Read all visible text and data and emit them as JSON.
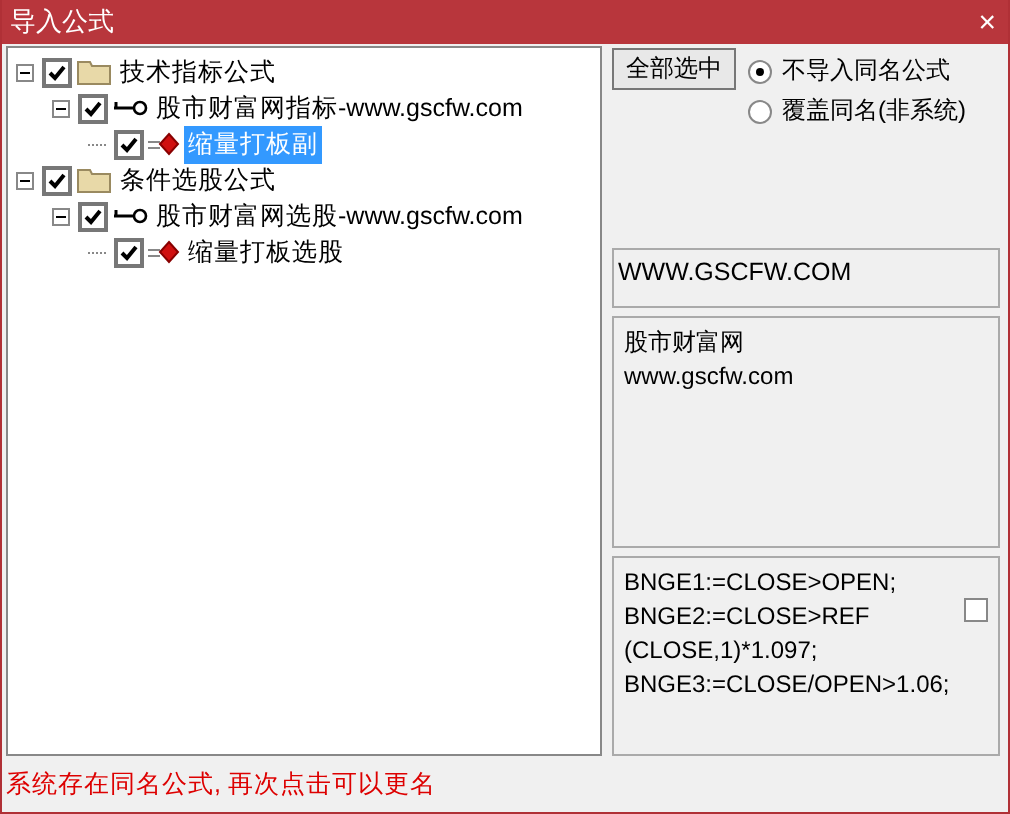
{
  "window": {
    "title": "导入公式",
    "close": "×"
  },
  "tree": [
    {
      "kind": "folder",
      "label": "技术指标公式",
      "checked": true,
      "expanded": true,
      "selected": false,
      "children": [
        {
          "kind": "group",
          "label": "股市财富网指标-www.gscfw.com",
          "checked": true,
          "expanded": true,
          "selected": false,
          "children": [
            {
              "kind": "formula",
              "label": "缩量打板副",
              "checked": true,
              "selected": true
            }
          ]
        }
      ]
    },
    {
      "kind": "folder",
      "label": "条件选股公式",
      "checked": true,
      "expanded": true,
      "selected": false,
      "children": [
        {
          "kind": "group",
          "label": "股市财富网选股-www.gscfw.com",
          "checked": true,
          "expanded": true,
          "selected": false,
          "children": [
            {
              "kind": "formula",
              "label": "缩量打板选股",
              "checked": true,
              "selected": false
            }
          ]
        }
      ]
    }
  ],
  "select_all_button": "全部选中",
  "options": [
    {
      "label": "不导入同名公式",
      "selected": true
    },
    {
      "label": "覆盖同名(非系统)",
      "selected": false
    }
  ],
  "site_field": "WWW.GSCFW.COM",
  "description": [
    "股市财富网",
    "www.gscfw.com"
  ],
  "code": {
    "lines": [
      "BNGE1:=CLOSE>OPEN;",
      "BNGE2:=CLOSE>REF",
      "(CLOSE,1)*1.097;",
      "BNGE3:=CLOSE/OPEN>1.06;"
    ],
    "checked": false
  },
  "status": "系统存在同名公式, 再次点击可以更名"
}
